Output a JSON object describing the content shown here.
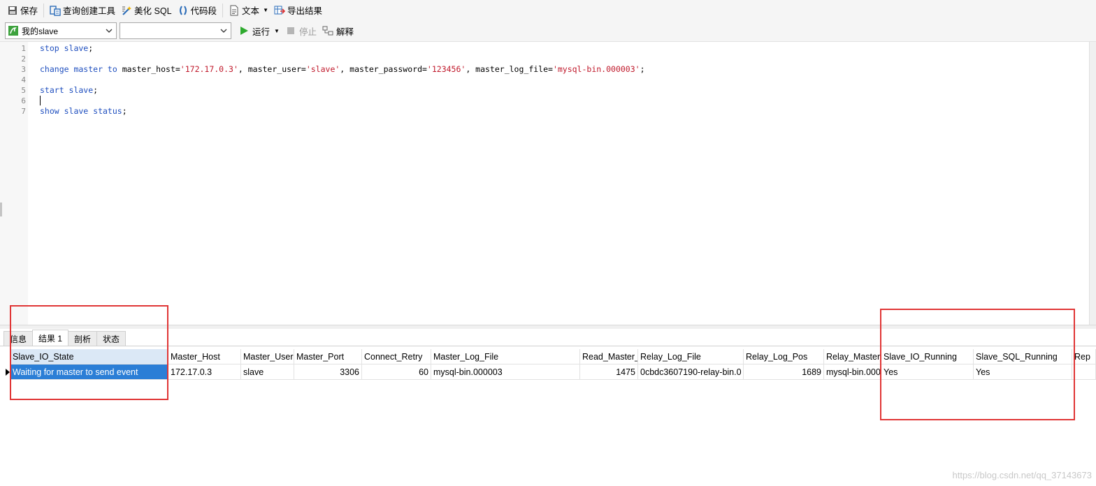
{
  "toolbar": {
    "save": "保存",
    "query_builder": "查询创建工具",
    "beautify_sql": "美化 SQL",
    "code_snippet": "代码段",
    "text": "文本",
    "export_result": "导出结果"
  },
  "toolbar2": {
    "connection": "我的slave",
    "database": "",
    "run": "运行",
    "stop": "停止",
    "explain": "解释"
  },
  "editor": {
    "line_numbers": [
      "1",
      "2",
      "3",
      "4",
      "5",
      "6",
      "7"
    ],
    "line1_kw": "stop slave",
    "line1_end": ";",
    "line3_kw1": "change master to",
    "line3_p1": " master_host=",
    "line3_s1": "'172.17.0.3'",
    "line3_p2": ", master_user=",
    "line3_s2": "'slave'",
    "line3_p3": ", master_password=",
    "line3_s3": "'123456'",
    "line3_p4": ", master_log_file=",
    "line3_s4": "'mysql-bin.000003'",
    "line3_end": ";",
    "line5_kw": "start slave",
    "line5_end": ";",
    "line7_kw": "show slave status",
    "line7_end": ";"
  },
  "result_tabs": [
    "信息",
    "结果 1",
    "剖析",
    "状态"
  ],
  "grid": {
    "headers": [
      "Slave_IO_State",
      "Master_Host",
      "Master_User",
      "Master_Port",
      "Connect_Retry",
      "Master_Log_File",
      "Read_Master_",
      "Relay_Log_File",
      "Relay_Log_Pos",
      "Relay_Master_",
      "Slave_IO_Running",
      "Slave_SQL_Running",
      "Rep"
    ],
    "row": [
      "Waiting for master to send event",
      "172.17.0.3",
      "slave",
      "3306",
      "60",
      "mysql-bin.000003",
      "1475",
      "0cbdc3607190-relay-bin.0",
      "1689",
      "mysql-bin.000",
      "Yes",
      "Yes",
      ""
    ]
  },
  "watermark": "https://blog.csdn.net/qq_37143673"
}
